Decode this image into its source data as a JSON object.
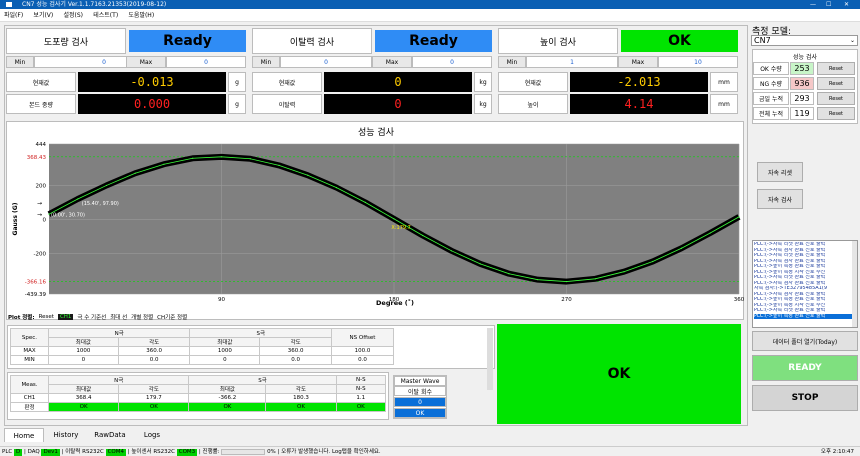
{
  "window": {
    "title": "CN7 성능 검사기 Ver.1.1.7163.21353(2019-08-12)"
  },
  "menu": [
    "파일(F)",
    "보기(V)",
    "설정(S)",
    "테스트(T)",
    "도움말(H)"
  ],
  "tests": [
    {
      "name": "도포량 검사",
      "status": "Ready",
      "status_color": "#2f8cf5",
      "min_label": "Min",
      "min": "0",
      "max_label": "Max",
      "max": "0",
      "r1_label": "현재값",
      "r1_value": "-0.013",
      "r1_unit": "g",
      "r1_color": "#ffcc00",
      "r2_label": "본드 중량",
      "r2_value": "0.000",
      "r2_unit": "g",
      "r2_color": "#ff2020"
    },
    {
      "name": "이탈력 검사",
      "status": "Ready",
      "status_color": "#2f8cf5",
      "min_label": "Min",
      "min": "0",
      "max_label": "Max",
      "max": "0",
      "r1_label": "현재값",
      "r1_value": "0",
      "r1_unit": "kg",
      "r1_color": "#ffcc00",
      "r2_label": "이탈력",
      "r2_value": "0",
      "r2_unit": "kg",
      "r2_color": "#ff2020"
    },
    {
      "name": "높이 검사",
      "status": "OK",
      "status_color": "#00e400",
      "min_label": "Min",
      "min": "1",
      "max_label": "Max",
      "max": "10",
      "r1_label": "현재값",
      "r1_value": "-2.013",
      "r1_unit": "mm",
      "r1_color": "#ffcc00",
      "r2_label": "높이",
      "r2_value": "4.14",
      "r2_unit": "mm",
      "r2_color": "#ff2020"
    }
  ],
  "chart_title": "성능 검사",
  "chart_data": {
    "type": "line",
    "xlabel": "Degree (˚)",
    "ylabel": "Gauss (G)",
    "xlim": [
      0,
      360
    ],
    "ylim": [
      -439.39,
      444
    ],
    "x_ticks": [
      "90",
      "180",
      "270",
      "360"
    ],
    "y_ticks": [
      "444",
      "368.43",
      "200",
      "0",
      "-200",
      "-366.16",
      "-439.39"
    ],
    "series": [
      {
        "x": [
          0,
          15,
          30,
          45,
          60,
          75,
          90,
          105,
          120,
          135,
          150,
          165,
          180,
          195,
          210,
          225,
          240,
          255,
          270,
          285,
          300,
          315,
          330,
          345,
          360
        ],
        "y": [
          30.7,
          120,
          200,
          272,
          325,
          360,
          368.4,
          357,
          318,
          260,
          187,
          100,
          3,
          -95,
          -185,
          -262,
          -320,
          -355,
          -366.2,
          -350,
          -308,
          -248,
          -170,
          -80,
          15
        ]
      }
    ],
    "annotations": [
      "(15.40', 97.90)",
      "(0.00', 30.70)",
      "X:179.7"
    ],
    "grid": true
  },
  "plot_toolbar": {
    "label": "Plot 정렬:",
    "items": [
      "Reset",
      "CH1",
      "극 수 기준선",
      "최대 선",
      "개별 정렬",
      "CH기준 정렬"
    ]
  },
  "spec_table": {
    "headers": [
      "Spec.",
      "N극",
      "S극",
      "NS Offset"
    ],
    "sub": [
      "최대값",
      "각도",
      "최대값",
      "각도"
    ],
    "rows": [
      [
        "MAX",
        "1000",
        "360.0",
        "1000",
        "360.0",
        "100.0"
      ],
      [
        "MIN",
        "0",
        "0.0",
        "0",
        "0.0",
        "0.0"
      ]
    ]
  },
  "meas_table": {
    "headers": [
      "Meas.",
      "N극",
      "S극",
      "N-S"
    ],
    "sub": [
      "최대값",
      "각도",
      "최대값",
      "각도",
      "N-S"
    ],
    "row": [
      "CH1",
      "368.4",
      "179.7",
      "-366.2",
      "180.3",
      "1.1"
    ],
    "judge": [
      "판정",
      "OK",
      "OK",
      "OK",
      "OK",
      "OK"
    ]
  },
  "master_wave": {
    "title": "Master Wave",
    "sub": "이탈 회수",
    "value": "0",
    "judge": "OK"
  },
  "result_big": "OK",
  "right": {
    "model_label": "측정 모델:",
    "model_value": "CN7",
    "counter_title": "성능 검사",
    "counters": [
      {
        "label": "OK 수량",
        "value": "253",
        "bg": "#c8f5c8",
        "reset": "Reset"
      },
      {
        "label": "NG 수량",
        "value": "936",
        "bg": "#f5c8c8",
        "reset": "Reset"
      },
      {
        "label": "금일 누적",
        "value": "293",
        "bg": "#ffffff",
        "reset": "Reset"
      },
      {
        "label": "전체 누적",
        "value": "119",
        "bg": "#ffffff",
        "reset": "Reset"
      }
    ],
    "btn1": "자속 리셋",
    "btn2": "자속 검사",
    "logs": [
      "PLC:(->자속 리셋 완료 신호 출력",
      "PLC:(->자속 검사 완료 신호 출력",
      "PLC:(->자속 리셋 완료 신호 출력",
      "PLC:(->자속 검사 완료 신호 출력",
      "PLC:(->높이 측정 완료 신호 출력",
      "PLC:(->높이 측정 시작 신호 수신",
      "PLC:(->자속 리셋 완료 신호 출력",
      "PLC:(->자속 검사 완료 신호 출력",
      "자속 검사:(->TE32795485A1(9",
      "PLC:(->자속 검사 완료 신호 출력",
      "PLC:(->높이 측정 완료 신호 출력",
      "PLC:(->높이 측정 시작 신호 수신",
      "PLC:(->자속 리셋 완료 신호 출력"
    ],
    "log_selected": "PLC:(->높이 측정 완료 신호 출력",
    "open_folder": "데이터 폴더 열기(Today)",
    "ready": "READY",
    "stop": "STOP"
  },
  "tabs": [
    "Home",
    "History",
    "RawData",
    "Logs"
  ],
  "statusbar": {
    "plc": "PLC",
    "plc_v": "D",
    "daq": "DAQ",
    "daq_v": "Dev1",
    "s1": "이탈력 RS232C",
    "s1_v": "COM4",
    "s2": "높이센서 RS232C",
    "s2_v": "COM3",
    "prog_label": "진행률:",
    "prog": "0%",
    "msg": "오류가 발생했습니다. Log탭을 확인하세요.",
    "time": "오후 2:10:47"
  }
}
